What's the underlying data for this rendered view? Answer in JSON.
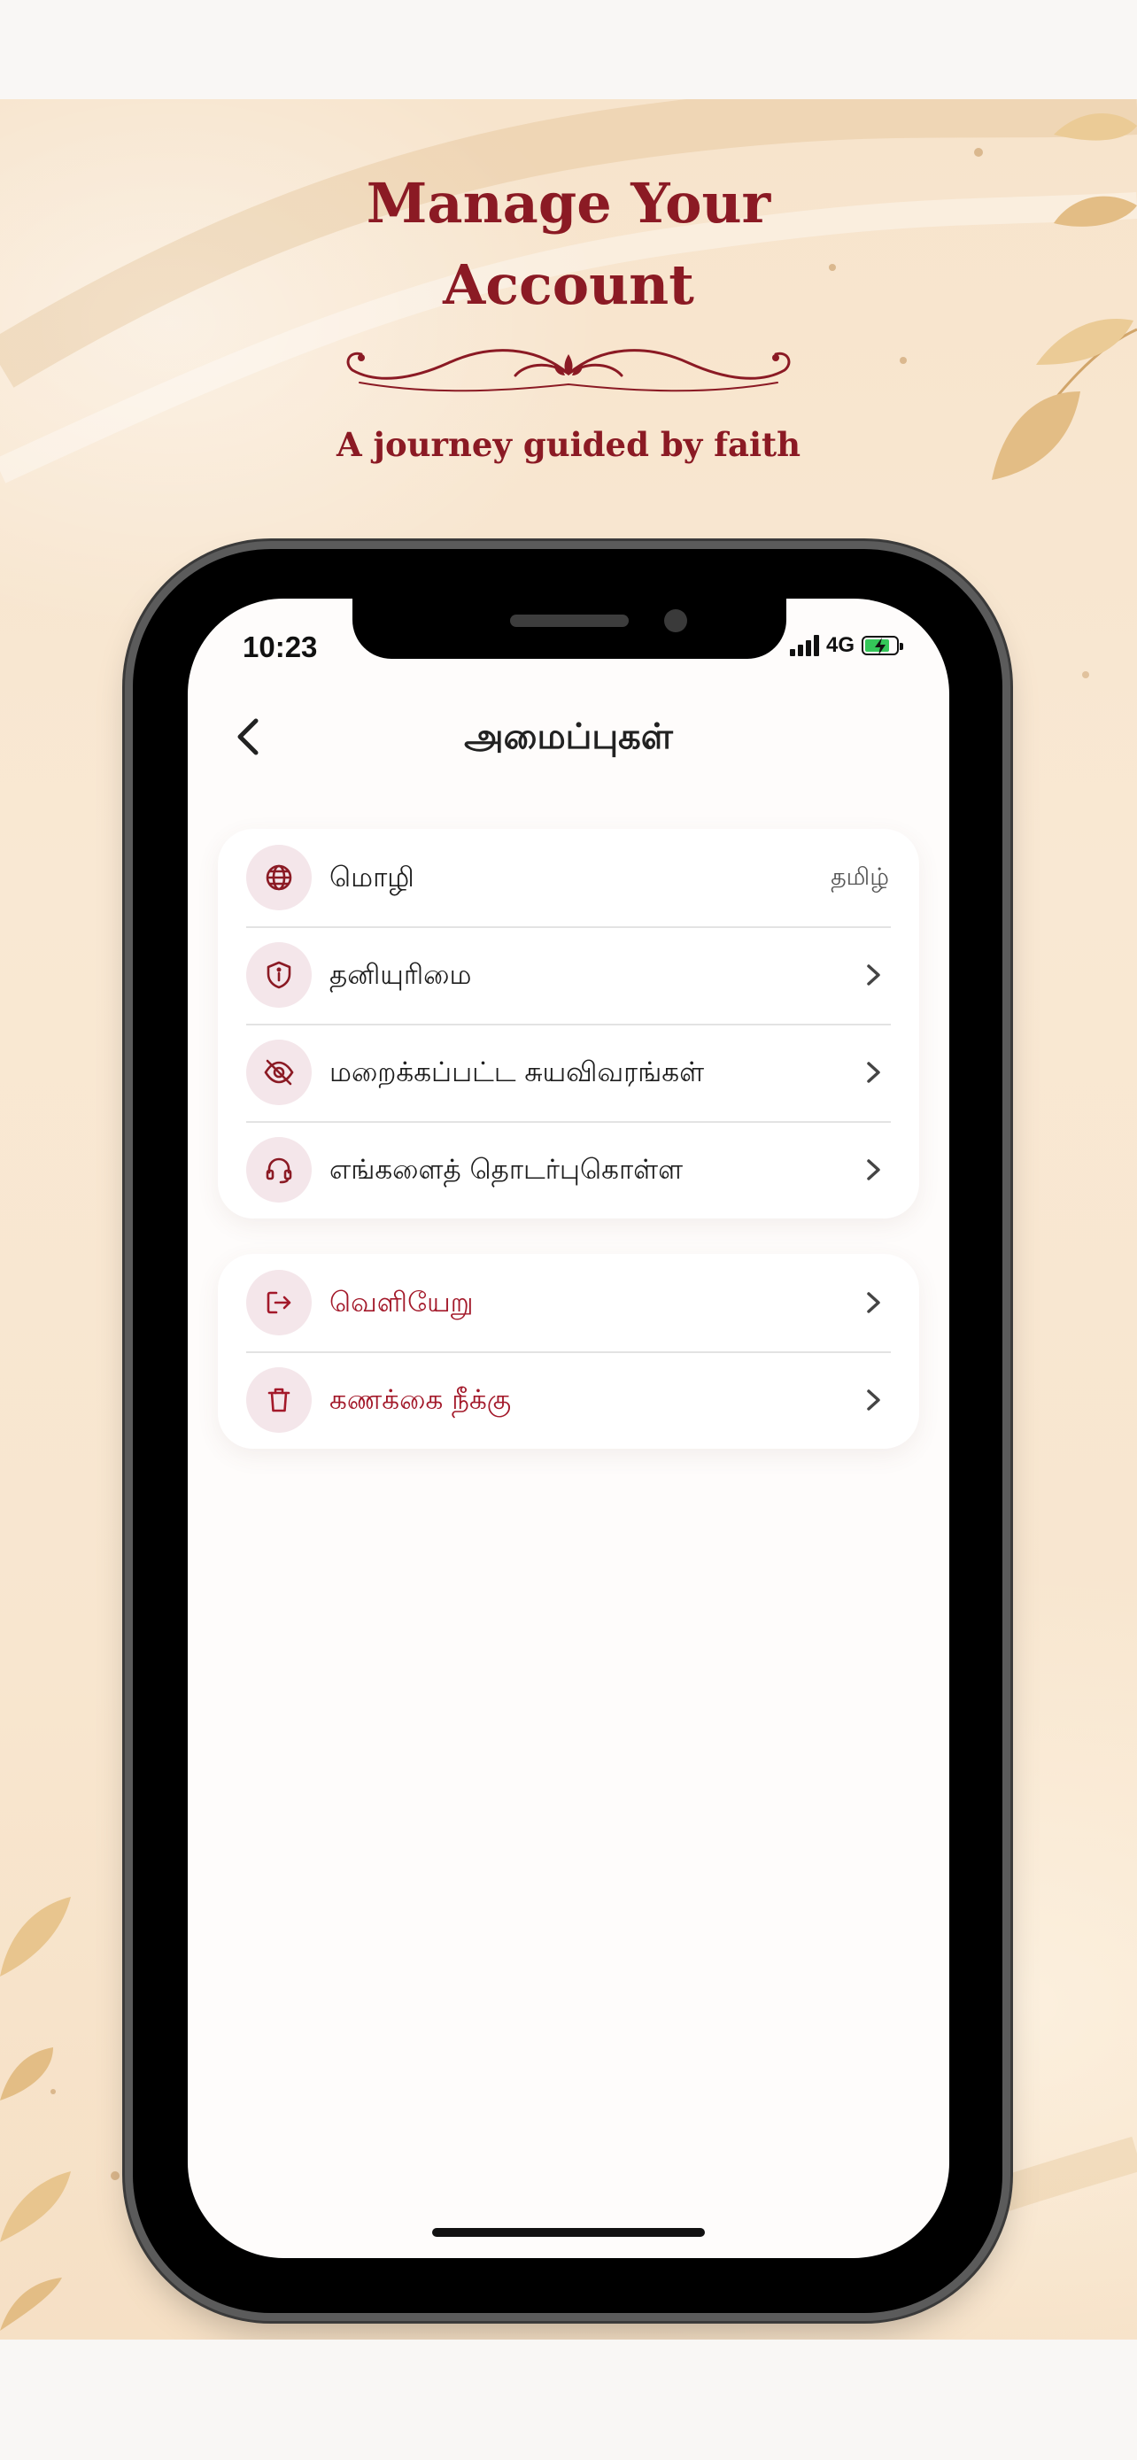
{
  "poster": {
    "title_line1": "Manage Your",
    "title_line2": "Account",
    "tagline": "A journey guided by faith"
  },
  "colors": {
    "brand": "#8b1a24",
    "danger": "#a3192a",
    "icon_bg": "#f4e6ea"
  },
  "status_bar": {
    "time": "10:23",
    "network": "4G",
    "battery": "charging"
  },
  "header": {
    "title": "அமைப்புகள்",
    "back_icon": "chevron-left-icon"
  },
  "settings": {
    "items": [
      {
        "label": "மொழி",
        "value": "தமிழ்",
        "icon": "globe-icon"
      },
      {
        "label": "தனியுரிமை",
        "icon": "shield-info-icon"
      },
      {
        "label": "மறைக்கப்பட்ட சுயவிவரங்கள்",
        "icon": "eye-off-icon"
      },
      {
        "label": "எங்களைத் தொடர்புகொள்ள",
        "icon": "headset-icon"
      }
    ]
  },
  "account": {
    "items": [
      {
        "label": "வெளியேறு",
        "icon": "logout-icon"
      },
      {
        "label": "கணக்கை நீக்கு",
        "icon": "trash-icon"
      }
    ]
  }
}
